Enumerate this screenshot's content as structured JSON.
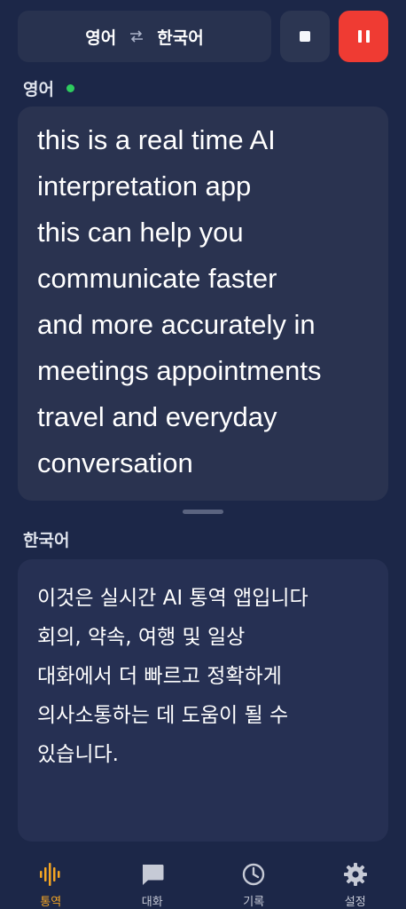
{
  "header": {
    "source_lang": "영어",
    "target_lang": "한국어",
    "swap_icon": "swap-arrows-icon",
    "stop_icon": "stop-icon",
    "pause_icon": "pause-icon",
    "pause_color": "#ef3b33"
  },
  "source": {
    "label": "영어",
    "live_indicator_color": "#2ecc5f",
    "text": "this is a real time AI\ninterpretation app\nthis can help you\ncommunicate faster\nand more accurately in\nmeetings appointments\ntravel and everyday\nconversation"
  },
  "target": {
    "label": "한국어",
    "text": "이것은 실시간 AI 통역 앱입니다\n회의, 약속, 여행 및 일상\n대화에서 더 빠르고 정확하게\n의사소통하는 데 도움이 될 수\n있습니다."
  },
  "nav": {
    "active_color": "#f5a623",
    "items": [
      {
        "label": "통역",
        "icon": "waveform-icon"
      },
      {
        "label": "대화",
        "icon": "chat-bubble-icon"
      },
      {
        "label": "기록",
        "icon": "clock-icon"
      },
      {
        "label": "설정",
        "icon": "gear-icon"
      }
    ]
  }
}
